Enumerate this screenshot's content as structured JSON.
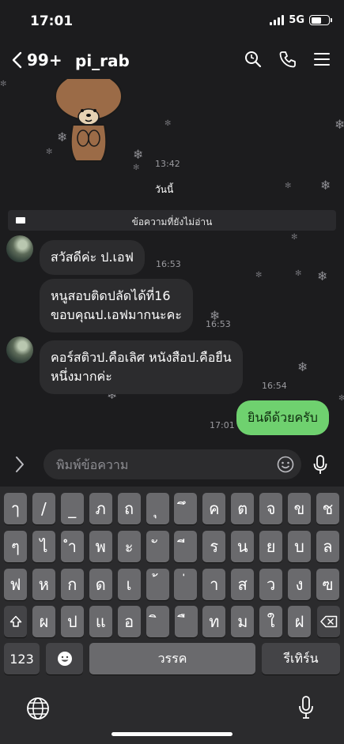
{
  "status_bar": {
    "time": "17:01",
    "network": "5G"
  },
  "header": {
    "back_count": "99+",
    "title": "pi_rab"
  },
  "chat": {
    "sticker_time": "13:42",
    "date_label": "วันนี้",
    "unread_label": "ข้อความที่ยังไม่อ่าน",
    "messages": [
      {
        "text": "สวัสดีค่ะ ป.เอฟ",
        "time": "16:53"
      },
      {
        "line1": "หนูสอบติดปลัดได้ที่16",
        "line2": "ขอบคุณป.เอฟมากนะคะ",
        "time": "16:53"
      },
      {
        "line1": "คอร์สติวป.คือเลิศ หนังสือป.คือยืน",
        "line2": "หนึ่งมากค่ะ",
        "time": "16:54"
      },
      {
        "text": "ยินดีด้วยครับ",
        "time": "17:01"
      }
    ]
  },
  "input": {
    "placeholder": "พิมพ์ข้อความ"
  },
  "keyboard": {
    "row1": [
      "ๅ",
      "/",
      "_",
      "ภ",
      "ถ",
      "ุ",
      "ึ",
      "ค",
      "ต",
      "จ",
      "ข",
      "ช"
    ],
    "row2": [
      "ๆ",
      "ไ",
      "ำ",
      "พ",
      "ะ",
      "ั",
      "ี",
      "ร",
      "น",
      "ย",
      "บ",
      "ล"
    ],
    "row3": [
      "ฟ",
      "ห",
      "ก",
      "ด",
      "เ",
      "้",
      "่",
      "า",
      "ส",
      "ว",
      "ง",
      "ฃ"
    ],
    "row4": [
      "ผ",
      "ป",
      "แ",
      "อ",
      "ิ",
      "ื",
      "ท",
      "ม",
      "ใ",
      "ฝ"
    ],
    "numbers_label": "123",
    "space_label": "วรรค",
    "return_label": "รีเทิร์น"
  },
  "colors": {
    "own_bubble": "#6fd16f",
    "incoming_bubble": "#2c2c2e",
    "background": "#1c1c1e"
  }
}
